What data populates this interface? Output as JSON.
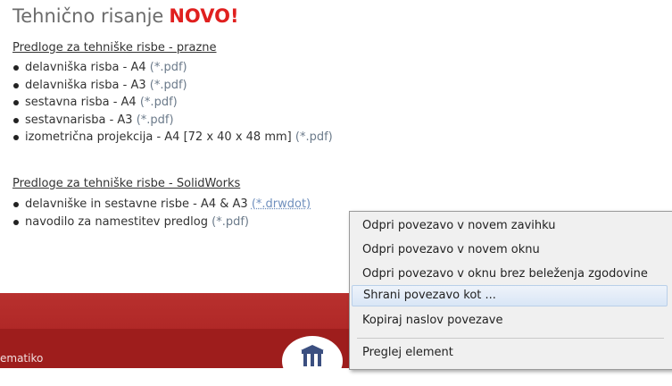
{
  "page": {
    "title_main": "Tehnično risanje",
    "title_badge": "NOVO!"
  },
  "sections": [
    {
      "heading": "Predloge za tehniške risbe - prazne",
      "items": [
        {
          "text": "delavniška risba - A4",
          "link": "(*.pdf)"
        },
        {
          "text": "delavniška risba - A3",
          "link": "(*.pdf)"
        },
        {
          "text": "sestavna risba - A4",
          "link": "(*.pdf)"
        },
        {
          "text": "sestavnarisba - A3",
          "link": "(*.pdf)"
        },
        {
          "text": "izometrična projekcija - A4 [72 x 40 x 48 mm]",
          "link": "(*.pdf)"
        }
      ]
    },
    {
      "heading": "Predloge za tehniške risbe - SolidWorks",
      "items": [
        {
          "text": "delavniške in sestavne risbe - A4 & A3",
          "link": "(*.drwdot)"
        },
        {
          "text": "navodilo za namestitev predlog",
          "link": "(*.pdf)"
        }
      ]
    }
  ],
  "footer": {
    "text": "ematiko"
  },
  "context_menu": {
    "items": [
      {
        "label": "Odpri povezavo v novem zavihku"
      },
      {
        "label": "Odpri povezavo v novem oknu"
      },
      {
        "label": "Odpri povezavo v oknu brez beleženja zgodovine"
      },
      {
        "label": "Shrani povezavo kot ...",
        "highlighted": true
      },
      {
        "label": "Kopiraj naslov povezave"
      },
      {
        "label": "Preglej element"
      }
    ]
  },
  "colors": {
    "badge": "#e0201f",
    "footer": "#a8201f",
    "menu_background": "#f0f0f0",
    "menu_highlight": "#d9e6f6"
  }
}
